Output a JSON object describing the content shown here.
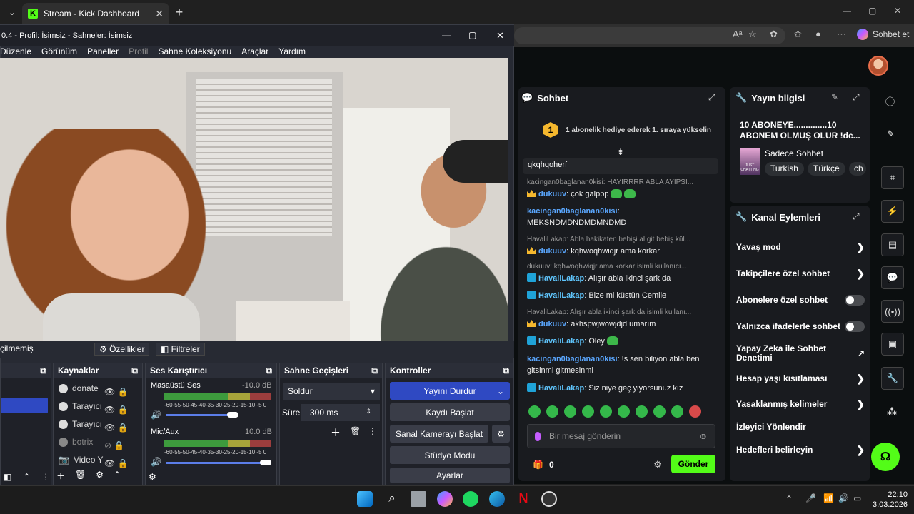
{
  "browser": {
    "tab_title": "Stream - Kick Dashboard",
    "copilot_label": "Sohbet et"
  },
  "obs": {
    "title": "0.4 - Profil: İsimsiz - Sahneler: İsimsiz",
    "menu": [
      "Düzenle",
      "Görünüm",
      "Paneller",
      "Profil",
      "Sahne Koleksiyonu",
      "Araçlar",
      "Yardım"
    ],
    "source_label": "çilmemiş",
    "props_label": "Özellikler",
    "filters_label": "Filtreler",
    "sources_title": "Kaynaklar",
    "sources": [
      "donate",
      "Tarayıcı",
      "Tarayıcı",
      "botrix",
      "Video Y"
    ],
    "mixer_title": "Ses Karıştırıcı",
    "mixer": [
      {
        "name": "Masaüstü Ses",
        "db": "-10.0 dB"
      },
      {
        "name": "Mic/Aux",
        "db": "10.0 dB"
      }
    ],
    "mixer_scale": "-60-55-50-45-40-35-30-25-20-15-10 -5  0",
    "transitions_title": "Sahne Geçişleri",
    "transition_value": "Soldur",
    "duration_label": "Süre",
    "duration_value": "300 ms",
    "controls_title": "Kontroller",
    "controls": [
      "Yayını Durdur",
      "Kaydı Başlat",
      "Sanal Kamerayı Başlat",
      "Stüdyo Modu",
      "Ayarlar"
    ]
  },
  "chat": {
    "title": "Sohbet",
    "gift_rank": "1",
    "gift_text": "1 abonelik hediye ederek 1. sıraya yükselin",
    "pinned": "qkqhqoherf",
    "messages": [
      {
        "reply": "kacingan0baglanan0kisi: HAYIRRRR ABLA AYIPSI...",
        "user": "dukuuv",
        "text": ": çok galppp"
      },
      {
        "user": "kacingan0baglanan0kisi",
        "text": ":",
        "line2": "MEKSNDMDNDMDMNDMD"
      },
      {
        "reply": "HavaliLakap: Abla hakikaten bebişi al git bebiş kül...",
        "user": "dukuuv",
        "text": ": kqhwoqhwiqjr ama korkar"
      },
      {
        "reply": "dukuuv: kqhwoqhwiqjr ama korkar isimli kullanıcı...",
        "user": "HavaliLakap",
        "text": ": Alışır abla ikinci şarkıda"
      },
      {
        "user": "HavaliLakap",
        "text": ": Bize mi küstün Cemile"
      },
      {
        "reply": "HavaliLakap: Alışır abla ikinci şarkıda isimli kullanı...",
        "user": "dukuuv",
        "text": ": akhspwjwowjdjd umarım"
      },
      {
        "user": "HavaliLakap",
        "text": ": Oley"
      },
      {
        "user": "kacingan0baglanan0kisi",
        "text": ": !s sen biliyon abla ben",
        "line2": "gitsinmi gitmesinmi"
      },
      {
        "user": "HavaliLakap",
        "text": ": Siz niye geç yiyorsunuz kız"
      }
    ],
    "input_placeholder": "Bir mesaj gönderin",
    "gift_count": "0",
    "send_label": "Gönder"
  },
  "stream_info": {
    "title": "Yayın bilgisi",
    "stream_title": "10 ABONEYE..............10 ABONEM OLMUŞ OLUR !dc...",
    "category": "Sadece Sohbet",
    "category_art_text": "JUST CHATTING",
    "tags": [
      "Turkish",
      "Türkçe",
      "ch"
    ]
  },
  "channel_actions": {
    "title": "Kanal Eylemleri",
    "items": [
      {
        "label": "Yavaş mod",
        "kind": "chevron"
      },
      {
        "label": "Takipçilere özel sohbet",
        "kind": "chevron"
      },
      {
        "label": "Abonelere özel sohbet",
        "kind": "toggle"
      },
      {
        "label": "Yalnızca ifadelerle sohbet",
        "kind": "toggle"
      },
      {
        "label": "Yapay Zeka ile Sohbet Denetimi",
        "kind": "external"
      },
      {
        "label": "Hesap yaşı kısıtlaması",
        "kind": "chevron"
      },
      {
        "label": "Yasaklanmış kelimeler",
        "kind": "chevron"
      },
      {
        "label": "İzleyici Yönlendir",
        "kind": "none"
      },
      {
        "label": "Hedefleri belirleyin",
        "kind": "chevron"
      }
    ]
  },
  "taskbar": {
    "time": "22:10",
    "date": "3.03.2026"
  },
  "colors": {
    "kick_green": "#53fc18",
    "obs_active": "#2f49c2"
  }
}
